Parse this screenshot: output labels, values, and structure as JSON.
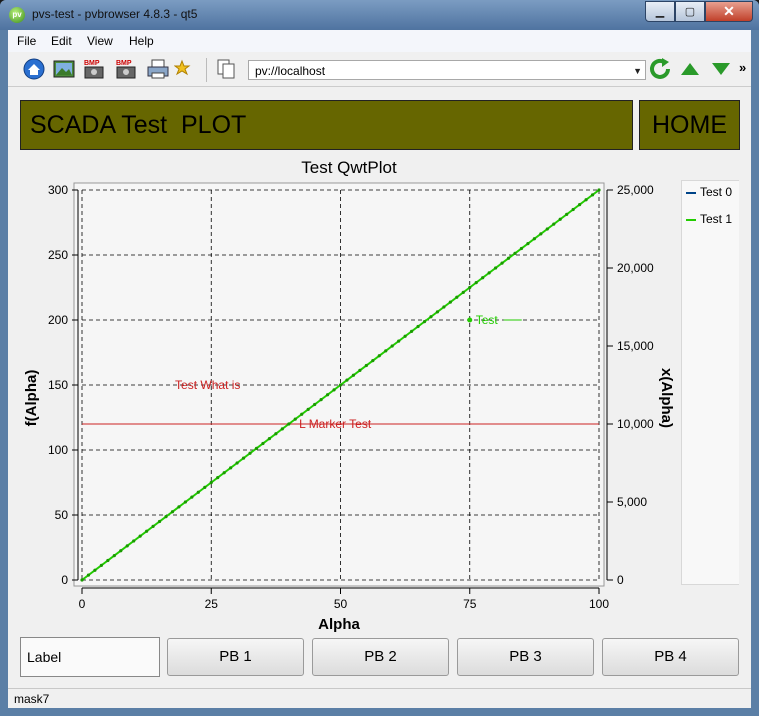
{
  "window": {
    "title": "pvs-test - pvbrowser 4.8.3 - qt5",
    "app_icon_text": "pv",
    "buttons": {
      "minimize": "▁",
      "maximize": "▢",
      "close": "✕"
    }
  },
  "menubar": {
    "items": [
      "File",
      "Edit",
      "View",
      "Help"
    ]
  },
  "toolbar": {
    "url": "pv://localhost",
    "icons": [
      "home-icon",
      "image-icon",
      "bmp-icon",
      "bmp-icon",
      "printer-icon",
      "star-icon",
      "copy-icon"
    ],
    "bmp_label": "BMP",
    "more": "»"
  },
  "header": {
    "title": "SCADA Test  PLOT",
    "home_button": "HOME"
  },
  "plot": {
    "marker_text": "Test What is",
    "line_marker_text": "L  Marker Test",
    "point_marker_text": "Test",
    "colors": {
      "curve1": "#22cc00",
      "marker": "#cc2222",
      "curve0": "#004488"
    }
  },
  "chart_data": {
    "type": "line",
    "title": "Test QwtPlot",
    "xlabel": "Alpha",
    "ylabel": "f(Alpha)",
    "y2label": "x(Alpha)",
    "xlim": [
      0,
      100
    ],
    "ylim": [
      0,
      300
    ],
    "y2lim": [
      0,
      25000
    ],
    "x_ticks": [
      "0",
      "25",
      "50",
      "75",
      "100"
    ],
    "y_ticks": [
      "0",
      "50",
      "100",
      "150",
      "200",
      "250",
      "300"
    ],
    "y2_ticks": [
      "0",
      "5,000",
      "10,000",
      "15,000",
      "20,000",
      "25,000"
    ],
    "grid": true,
    "legend": "right",
    "series": [
      {
        "name": "Test 0",
        "x": [],
        "y": []
      },
      {
        "name": "Test 1",
        "x": [
          0,
          10,
          20,
          30,
          40,
          50,
          60,
          70,
          80,
          90,
          100
        ],
        "y": [
          0,
          30,
          60,
          90,
          120,
          150,
          180,
          210,
          240,
          270,
          300
        ]
      }
    ],
    "hline": {
      "y": 120,
      "label": "L  Marker Test"
    },
    "point_marker": {
      "x": 75,
      "y": 200,
      "label": "Test"
    },
    "text_marker": {
      "x": 25,
      "y": 150,
      "label": "Test What is"
    }
  },
  "buttons": {
    "label": "Label",
    "pb": [
      "PB 1",
      "PB 2",
      "PB 3",
      "PB 4"
    ]
  },
  "status": {
    "text": "mask7"
  }
}
